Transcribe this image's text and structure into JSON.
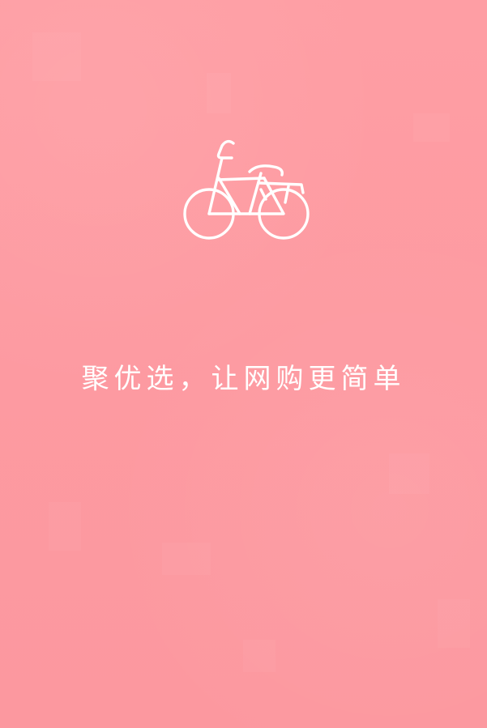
{
  "splash": {
    "logo_icon": "bicycle-icon",
    "slogan": "聚优选，让网购更简单",
    "background_color": "#fe9ca2",
    "foreground_color": "#ffffff"
  }
}
